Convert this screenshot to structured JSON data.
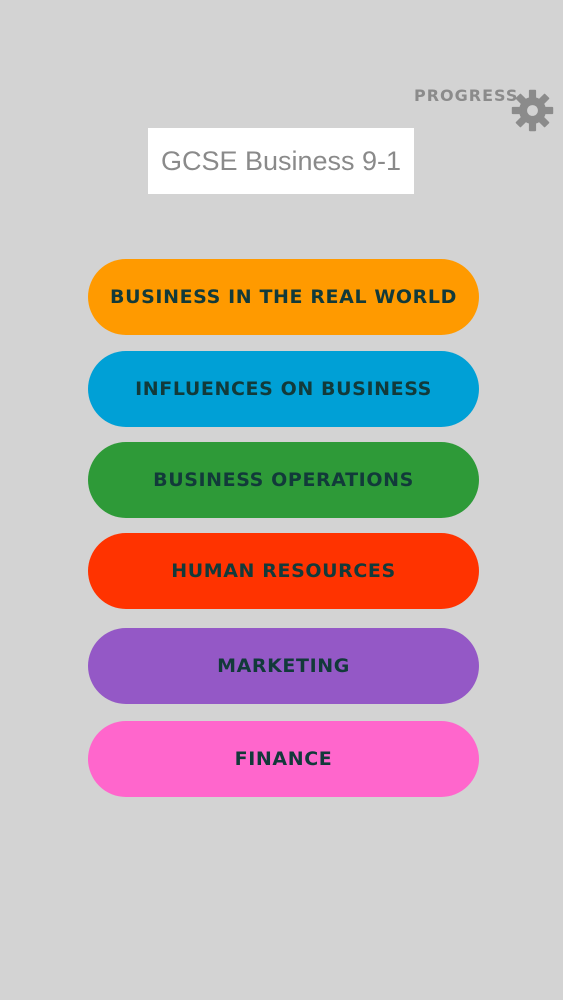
{
  "header": {
    "progress_label": "PROGRESS",
    "settings_icon": "gear-icon",
    "title": "GCSE Business 9-1"
  },
  "topics": [
    {
      "label": "BUSINESS IN THE REAL WORLD",
      "color": "#ff9a00"
    },
    {
      "label": "INFLUENCES ON BUSINESS",
      "color": "#00a0d6"
    },
    {
      "label": "BUSINESS OPERATIONS",
      "color": "#2e9a38"
    },
    {
      "label": "HUMAN RESOURCES",
      "color": "#ff3300"
    },
    {
      "label": "MARKETING",
      "color": "#9458c6"
    },
    {
      "label": "FINANCE",
      "color": "#ff66cc"
    }
  ],
  "colors": {
    "background": "#d3d3d3",
    "label_text": "#123a3a",
    "muted_text": "#8b8b8b"
  }
}
